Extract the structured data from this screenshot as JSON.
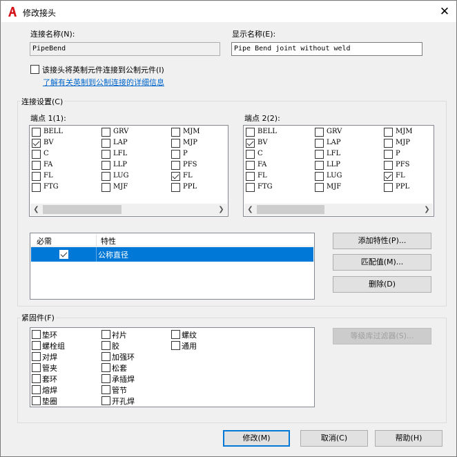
{
  "window": {
    "title": "修改接头",
    "close_glyph": "✕"
  },
  "fields": {
    "connection_name_label": "连接名称(N):",
    "connection_name_value": "PipeBend",
    "display_name_label": "显示名称(E):",
    "display_name_value": "Pipe Bend joint without weld"
  },
  "imperial_to_metric": {
    "label": "该接头将英制元件连接到公制元件(I)",
    "checked": false
  },
  "info_link": "了解有关英制到公制连接的详细信息",
  "connection_settings": {
    "title": "连接设置(C)",
    "end1_label": "端点 1(1):",
    "end2_label": "端点 2(2):",
    "end1_items": [
      {
        "label": "BELL",
        "checked": false
      },
      {
        "label": "GRV",
        "checked": false
      },
      {
        "label": "MJM",
        "checked": false
      },
      {
        "label": "BV",
        "checked": true
      },
      {
        "label": "LAP",
        "checked": false
      },
      {
        "label": "MJP",
        "checked": false
      },
      {
        "label": "C",
        "checked": false
      },
      {
        "label": "LFL",
        "checked": false
      },
      {
        "label": "P",
        "checked": false
      },
      {
        "label": "FA",
        "checked": false
      },
      {
        "label": "LLP",
        "checked": false
      },
      {
        "label": "PFS",
        "checked": false
      },
      {
        "label": "FL",
        "checked": false
      },
      {
        "label": "LUG",
        "checked": false
      },
      {
        "label": "FL",
        "checked": true
      },
      {
        "label": "FTG",
        "checked": false
      },
      {
        "label": "MJF",
        "checked": false
      },
      {
        "label": "PPL",
        "checked": false
      }
    ],
    "end2_items": [
      {
        "label": "BELL",
        "checked": false
      },
      {
        "label": "GRV",
        "checked": false
      },
      {
        "label": "MJM",
        "checked": false
      },
      {
        "label": "BV",
        "checked": true
      },
      {
        "label": "LAP",
        "checked": false
      },
      {
        "label": "MJP",
        "checked": false
      },
      {
        "label": "C",
        "checked": false
      },
      {
        "label": "LFL",
        "checked": false
      },
      {
        "label": "P",
        "checked": false
      },
      {
        "label": "FA",
        "checked": false
      },
      {
        "label": "LLP",
        "checked": false
      },
      {
        "label": "PFS",
        "checked": false
      },
      {
        "label": "FL",
        "checked": false
      },
      {
        "label": "LUG",
        "checked": false
      },
      {
        "label": "FL",
        "checked": true
      },
      {
        "label": "FTG",
        "checked": false
      },
      {
        "label": "MJF",
        "checked": false
      },
      {
        "label": "PPL",
        "checked": false
      }
    ],
    "property_grid": {
      "col_required": "必需",
      "col_property": "特性",
      "rows": [
        {
          "required": true,
          "property": "公称直径"
        }
      ]
    },
    "add_property_button": "添加特性(P)...",
    "match_value_button": "匹配值(M)...",
    "delete_button": "删除(D)"
  },
  "fasteners": {
    "title": "紧固件(F)",
    "items": [
      {
        "label": "垫环",
        "checked": false
      },
      {
        "label": "衬片",
        "checked": false
      },
      {
        "label": "螺纹",
        "checked": false
      },
      {
        "label": "螺栓组",
        "checked": false
      },
      {
        "label": "胶",
        "checked": false
      },
      {
        "label": "通用",
        "checked": false
      },
      {
        "label": "对焊",
        "checked": false
      },
      {
        "label": "加强环",
        "checked": false
      },
      {
        "label": "管夹",
        "checked": false
      },
      {
        "label": "松套",
        "checked": false
      },
      {
        "label": "套环",
        "checked": false
      },
      {
        "label": "承插焊",
        "checked": false
      },
      {
        "label": "熔焊",
        "checked": false
      },
      {
        "label": "管节",
        "checked": false
      },
      {
        "label": "垫圈",
        "checked": false
      },
      {
        "label": "开孔焊",
        "checked": false
      }
    ],
    "filter_button": "等级库过滤器(S)..."
  },
  "footer": {
    "ok_button": "修改(M)",
    "cancel_button": "取消(C)",
    "help_button": "帮助(H)"
  },
  "colors": {
    "accent": "#0078d7",
    "link": "#0066cc",
    "app_icon": "#d3141b"
  }
}
